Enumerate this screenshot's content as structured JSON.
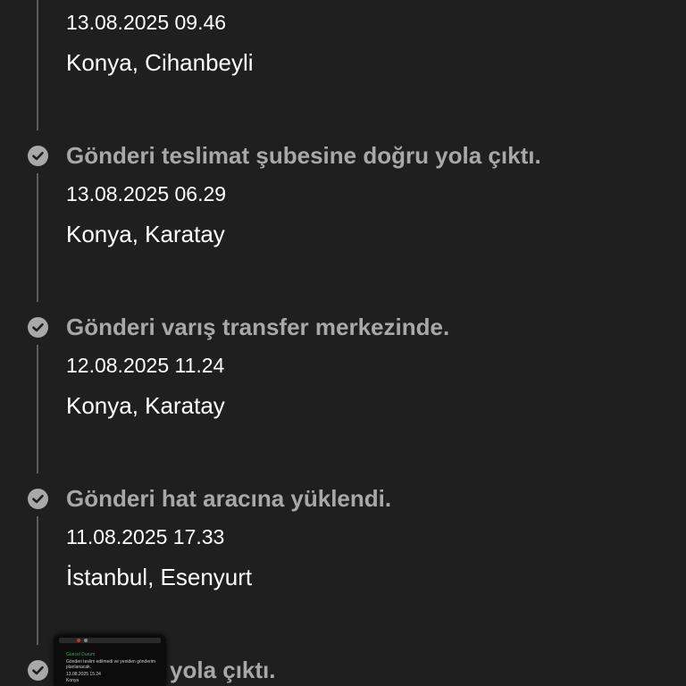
{
  "timeline": {
    "events": [
      {
        "status": "",
        "datetime": "13.08.2025 09.46",
        "location": "Konya, Cihanbeyli"
      },
      {
        "status": "Gönderi teslimat şubesine doğru yola çıktı.",
        "datetime": "13.08.2025 06.29",
        "location": "Konya, Karatay"
      },
      {
        "status": "Gönderi varış transfer merkezinde.",
        "datetime": "12.08.2025 11.24",
        "location": "Konya, Karatay"
      },
      {
        "status": "Gönderi hat aracına yüklendi.",
        "datetime": "11.08.2025 17.33",
        "location": "İstanbul, Esenyurt"
      },
      {
        "status": "yola çıktı.",
        "datetime": "",
        "location": ""
      }
    ]
  },
  "thumbnail": {
    "heading": "Güncel Durum",
    "line1": "Gönderi teslim edilmedi ve yeniden gönderim",
    "line2": "planlanacak.",
    "line3": "13.08.2025 15.24",
    "line4": "Konya"
  },
  "colors": {
    "background": "#1f1f1f",
    "status_text": "#a8a8a8",
    "primary_text": "#ffffff",
    "check_icon": "#a9a9a9",
    "timeline_line": "#5c5c5c"
  }
}
